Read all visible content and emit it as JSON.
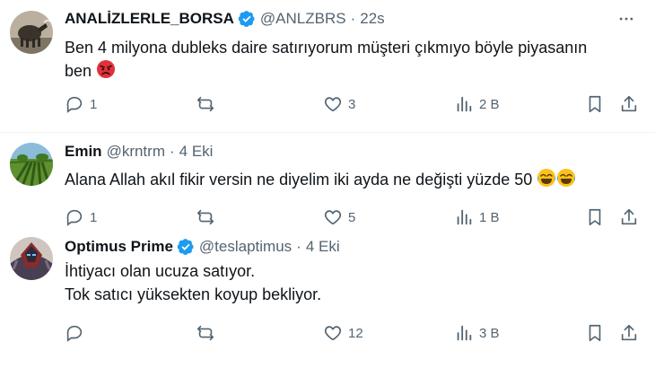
{
  "tweets": [
    {
      "name": "ANALİZLERLE_BORSA",
      "handle": "@ANLZBRS",
      "separator": "·",
      "time": "22s",
      "verified": true,
      "text_lines": [
        "Ben 4 milyona dubleks daire satırıyorum müşteri çıkmıyo böyle piyasanın",
        "ben"
      ],
      "emoji": "angry-face",
      "replies": "1",
      "reposts": "",
      "likes": "3",
      "views": "2 B"
    },
    {
      "name": "Emin",
      "handle": "@krntrm",
      "separator": "·",
      "time": "4 Eki",
      "verified": false,
      "text_lines": [
        "Alana Allah akıl fikir versin ne diyelim iki ayda ne değişti yüzde 50"
      ],
      "emoji": "crying-laughing-face",
      "replies": "1",
      "reposts": "",
      "likes": "5",
      "views": "1 B"
    },
    {
      "name": "Optimus Prime",
      "handle": "@teslaptimus",
      "separator": "·",
      "time": "4 Eki",
      "verified": true,
      "text_lines": [
        "İhtiyacı olan ucuza satıyor.",
        "Tok satıcı yüksekten koyup bekliyor."
      ],
      "emoji": "",
      "replies": "",
      "reposts": "",
      "likes": "12",
      "views": "3 B"
    }
  ],
  "colors": {
    "text": "#0f1419",
    "secondary": "#536471",
    "verified": "#1d9bf0",
    "divider": "#eff3f4"
  },
  "icons": [
    "reply-icon",
    "repost-icon",
    "like-icon",
    "views-icon",
    "bookmark-icon",
    "share-icon",
    "more-icon",
    "verified-badge-icon"
  ]
}
